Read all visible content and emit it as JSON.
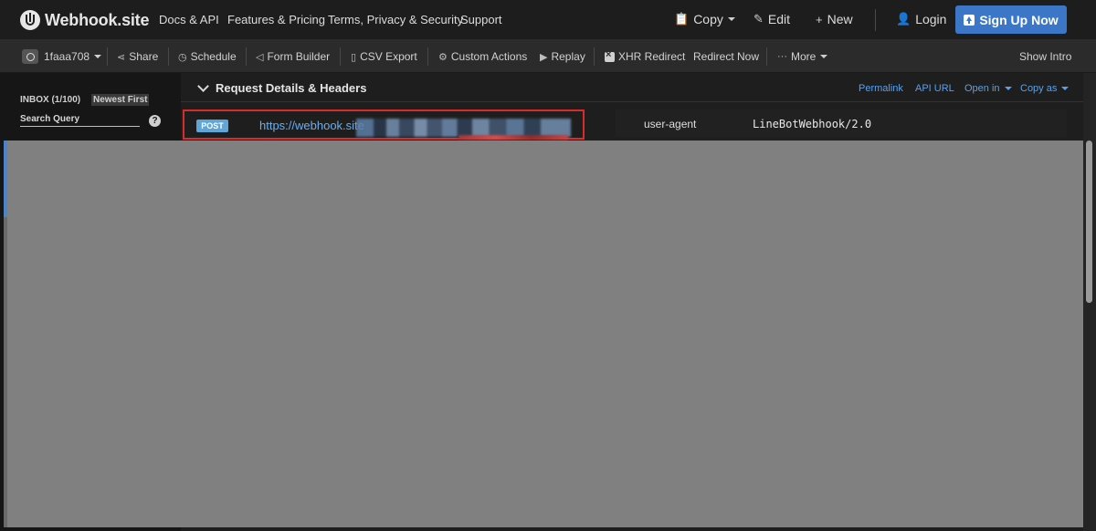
{
  "navbar": {
    "brand": "Webhook.site",
    "links": [
      "Docs & API",
      "Features & Pricing",
      "Terms, Privacy & Security",
      "Support"
    ],
    "copy_label": "Copy",
    "edit_label": "Edit",
    "new_label": "New",
    "login_label": "Login",
    "signup_label": "Sign Up Now"
  },
  "toolbar": {
    "token_label": "1faaa708",
    "share_label": "Share",
    "schedule_label": "Schedule",
    "form_builder_label": "Form Builder",
    "csv_export_label": "CSV Export",
    "custom_actions_label": "Custom Actions",
    "replay_label": "Replay",
    "xhr_redirect_label": "XHR Redirect",
    "redirect_now_label": "Redirect Now",
    "more_label": "More",
    "show_intro_label": "Show Intro"
  },
  "sidebar": {
    "inbox_label": "INBOX (1/100)",
    "sort_label": "Newest First",
    "search_placeholder": "Search Query"
  },
  "request_details": {
    "title": "Request Details & Headers",
    "permalink_label": "Permalink",
    "api_url_label": "API URL",
    "open_in_label": "Open in",
    "copy_as_label": "Copy as",
    "method": "POST",
    "url_visible": "https://webhook.site",
    "header_key": "user-agent",
    "header_value": "LineBotWebhook/2.0"
  },
  "colors": {
    "accent_blue": "#3b77c6",
    "link_blue": "#5aa0ea",
    "highlight_red": "#d92b2b",
    "post_badge": "#5fa5d8",
    "overlay_gray": "#808080"
  }
}
